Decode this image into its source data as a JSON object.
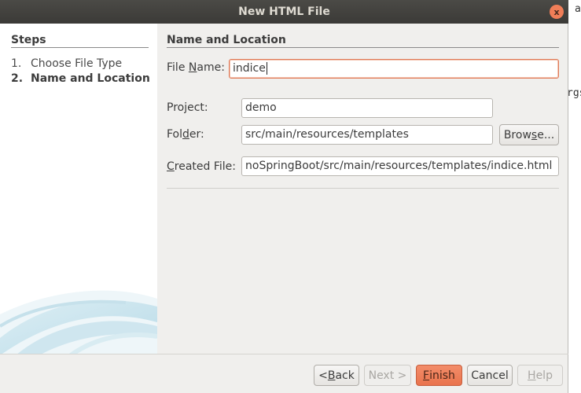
{
  "window": {
    "title": "New HTML File",
    "close_glyph": "x"
  },
  "background_editor": {
    "line1": "at",
    "line2": "rgs"
  },
  "steps": {
    "title": "Steps",
    "items": [
      {
        "num": "1.",
        "label": "Choose File Type"
      },
      {
        "num": "2.",
        "label": "Name and Location"
      }
    ]
  },
  "main": {
    "section_title": "Name and Location",
    "file_name": {
      "label_pre": "File ",
      "label_mn": "N",
      "label_post": "ame:",
      "value": "indice"
    },
    "project": {
      "label": "Project:",
      "value": "demo"
    },
    "folder": {
      "label_pre": "Fol",
      "label_mn": "d",
      "label_post": "er:",
      "value": "src/main/resources/templates"
    },
    "browse": {
      "pre": "Brow",
      "mn": "s",
      "post": "e..."
    },
    "created_file": {
      "label_pre": "",
      "label_mn": "C",
      "label_post": "reated File:",
      "value": "noSpringBoot/src/main/resources/templates/indice.html"
    }
  },
  "buttons": {
    "back": {
      "pre": "< ",
      "mn": "B",
      "post": "ack"
    },
    "next": "Next >",
    "finish": {
      "mn": "F",
      "post": "inish"
    },
    "cancel": "Cancel",
    "help": {
      "mn": "H",
      "post": "elp"
    }
  },
  "colors": {
    "accent": "#e9734d",
    "titlebar": "#3b3a37",
    "panel_bg": "#f0efed"
  }
}
